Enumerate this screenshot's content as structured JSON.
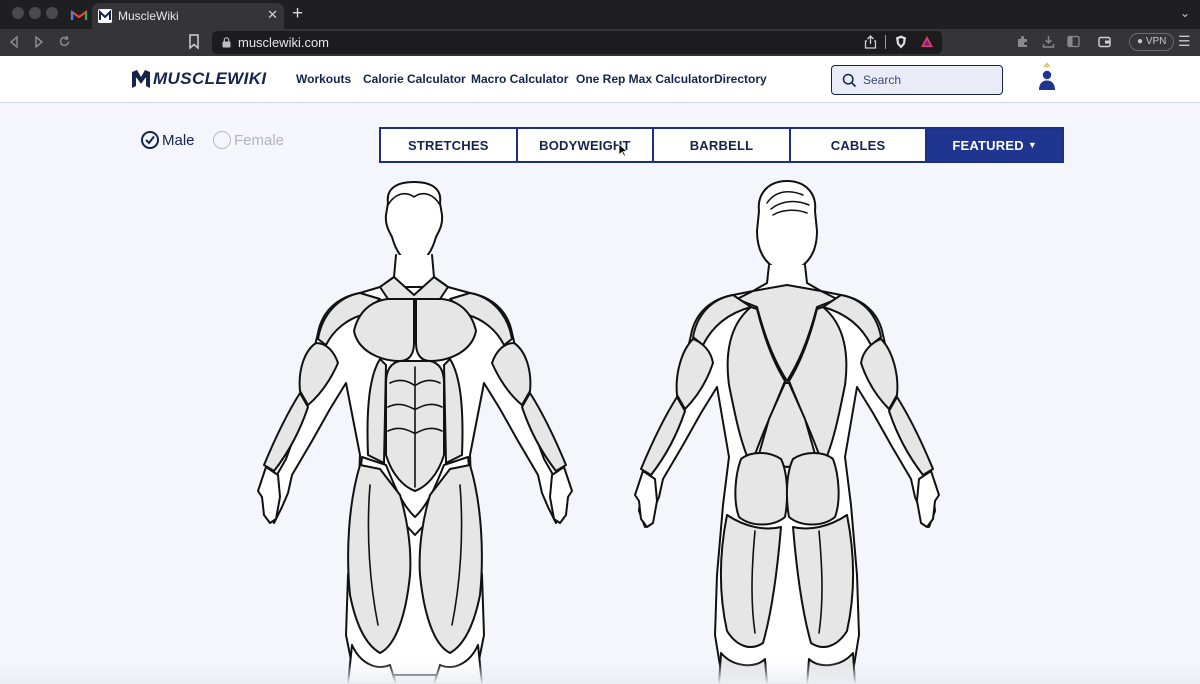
{
  "browser": {
    "tab_title": "MuscleWiki",
    "url": "musclewiki.com",
    "vpn_label": "VPN"
  },
  "header": {
    "logo_text": "MUSCLEWIKI",
    "nav": [
      "Workouts",
      "Calorie Calculator",
      "Macro Calculator",
      "One Rep Max Calculator",
      "Directory"
    ],
    "search_placeholder": "Search"
  },
  "gender": {
    "male": "Male",
    "female": "Female",
    "selected": "Male"
  },
  "categories": [
    "STRETCHES",
    "BODYWEIGHT",
    "BARBELL",
    "CABLES",
    "FEATURED"
  ],
  "colors": {
    "brand_navy": "#16234d",
    "featured_blue": "#1f3590",
    "muscle_fill": "#e6e6e6"
  }
}
